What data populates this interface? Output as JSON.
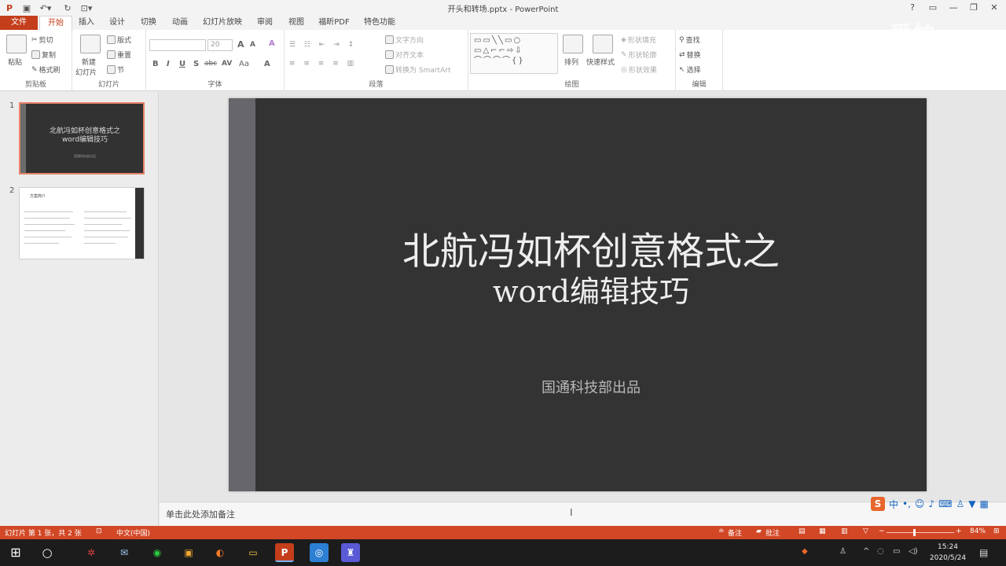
{
  "window": {
    "title": "开头和转场.pptx - PowerPoint",
    "help": "?",
    "minimize": "—",
    "restore": "❐",
    "close": "✕"
  },
  "watermark": "爱拍",
  "tabs": [
    {
      "label": "文件"
    },
    {
      "label": "开始"
    },
    {
      "label": "插入"
    },
    {
      "label": "设计"
    },
    {
      "label": "切换"
    },
    {
      "label": "动画"
    },
    {
      "label": "幻灯片放映"
    },
    {
      "label": "审阅"
    },
    {
      "label": "视图"
    },
    {
      "label": "福昕PDF"
    },
    {
      "label": "特色功能"
    }
  ],
  "ribbon": {
    "clipboard": {
      "paste": "粘贴",
      "cut": "剪切",
      "copy": "复制",
      "painter": "格式刷",
      "group": "剪贴板"
    },
    "slides": {
      "new_slide_1": "新建",
      "new_slide_2": "幻灯片",
      "layout": "版式",
      "reset": "重置",
      "section": "节",
      "group": "幻灯片"
    },
    "font": {
      "size": "20",
      "bold": "B",
      "italic": "I",
      "underline": "U",
      "shadow": "S",
      "strike": "abc",
      "spacing": "AV",
      "case": "Aa",
      "color": "A",
      "grow": "A",
      "shrink": "A",
      "clear": "A",
      "group": "字体"
    },
    "paragraph": {
      "direction": "文字方向",
      "align_text": "对齐文本",
      "smartart": "转换为 SmartArt",
      "group": "段落"
    },
    "drawing": {
      "shapes": "▭▭╲╲▭○\n▭△⌐⌐⇨⇩\n⌒⌒⌒⌒{}",
      "arrange": "排列",
      "quick_styles": "快速样式",
      "fill": "形状填充",
      "outline": "形状轮廓",
      "effects": "形状效果",
      "group": "绘图"
    },
    "editing": {
      "find": "查找",
      "replace": "替换",
      "select": "选择",
      "group": "编辑"
    }
  },
  "thumbnails": {
    "slide1": {
      "num": "1",
      "title": "北航冯如杯创意格式之",
      "title2": "word编辑技巧",
      "sub": "国通科技部出品"
    },
    "slide2": {
      "num": "2",
      "heading": "方案简介"
    }
  },
  "slide": {
    "title": "北航冯如杯创意格式之",
    "title2": "word编辑技巧",
    "subtitle": "国通科技部出品"
  },
  "notes": {
    "placeholder": "单击此处添加备注"
  },
  "ime": {
    "logo": "S",
    "mode": "中"
  },
  "status": {
    "slide_info": "幻灯片 第 1 张，共 2 张",
    "language": "中文(中国)",
    "notes": "备注",
    "comments": "批注",
    "zoom": "84%",
    "zoom_minus": "−",
    "zoom_plus": "+"
  },
  "taskbar": {
    "time": "15:24",
    "date": "2020/5/24",
    "apps": [
      "chrome-like",
      "mail",
      "wechat",
      "files",
      "firefox",
      "explorer",
      "powerpoint",
      "browser",
      "app"
    ]
  },
  "colors": {
    "accent": "#d24726",
    "file_tab": "#c43e1c",
    "slide_bg": "#333333",
    "slide_bar": "#66666b"
  }
}
